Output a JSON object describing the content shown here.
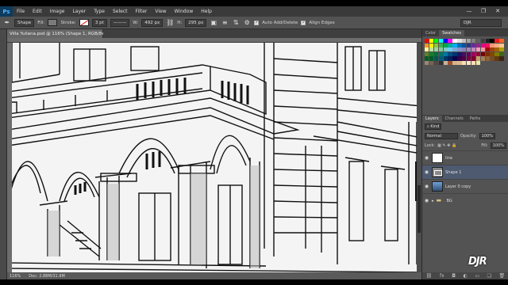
{
  "app": {
    "logo": "Ps"
  },
  "menu": [
    "File",
    "Edit",
    "Image",
    "Layer",
    "Type",
    "Select",
    "Filter",
    "View",
    "Window",
    "Help"
  ],
  "window_controls": [
    "—",
    "❐",
    "✕"
  ],
  "options": {
    "mode": "Shape",
    "fill_label": "Fill:",
    "stroke_label": "Stroke:",
    "stroke_width": "3 pt",
    "w_label": "W:",
    "w_value": "492 px",
    "h_label": "H:",
    "h_value": "295 px",
    "auto_add_delete": "Auto Add/Delete",
    "align_edges": "Align Edges",
    "workspace": "DJR"
  },
  "document": {
    "tab_title": "Villa Yuliana.psd @ 116% (Shape 1, RGB/8#) *",
    "zoom": "116%",
    "doc_size": "Doc: 2.88M/31.9M"
  },
  "panels": {
    "top_tabs": [
      "Color",
      "Swatches"
    ],
    "layer_tabs": [
      "Layers",
      "Channels",
      "Paths"
    ],
    "kind_label": "Kind",
    "blend_mode": "Normal",
    "opacity_label": "Opacity:",
    "opacity_value": "100%",
    "lock_label": "Lock:",
    "fill_label": "Fill:",
    "fill_value": "100%",
    "layers": [
      {
        "name": "line",
        "kind": "white"
      },
      {
        "name": "Shape 1",
        "kind": "shape",
        "selected": true
      },
      {
        "name": "Layer 0 copy",
        "kind": "photo"
      },
      {
        "name": "BG",
        "kind": "folder"
      }
    ],
    "footer_icons": [
      "link-icon",
      "fx-icon",
      "mask-icon",
      "adjustment-icon",
      "folder-icon",
      "new-layer-icon",
      "trash-icon"
    ]
  },
  "swatch_colors": [
    "#ff0000",
    "#ffff00",
    "#00ff00",
    "#00ffff",
    "#0000ff",
    "#ff00ff",
    "#ffffff",
    "#e0e0e0",
    "#c0c0c0",
    "#a0a0a0",
    "#808080",
    "#606060",
    "#404040",
    "#202020",
    "#000000",
    "#ed1c24",
    "#f26522",
    "#f7941d",
    "#fff200",
    "#8dc63f",
    "#39b54a",
    "#00a651",
    "#00a99d",
    "#00aeef",
    "#0072bc",
    "#0054a6",
    "#2e3192",
    "#662d91",
    "#92278f",
    "#ec008c",
    "#ed145b",
    "#f69679",
    "#f9ad81",
    "#fdc68a",
    "#fff799",
    "#c4df9b",
    "#a3d39c",
    "#82ca9c",
    "#7accc8",
    "#6dcff6",
    "#7da7d9",
    "#8393ca",
    "#8781bd",
    "#a186be",
    "#bd8cbf",
    "#f49ac1",
    "#f5989d",
    "#9e0b0f",
    "#a0410d",
    "#a36209",
    "#aba000",
    "#598527",
    "#1a7b30",
    "#007236",
    "#00746b",
    "#0076a3",
    "#004b80",
    "#003471",
    "#1b1464",
    "#440e62",
    "#630460",
    "#9e005d",
    "#9e0039",
    "#790000",
    "#7b2e00",
    "#7d4900",
    "#827b00",
    "#406618",
    "#005e20",
    "#005826",
    "#005952",
    "#005b7f",
    "#003663",
    "#002157",
    "#0d004c",
    "#32004b",
    "#4b0049",
    "#7b0046",
    "#7a0026",
    "#c69c6d",
    "#a67c52",
    "#8c6239",
    "#754c24",
    "#603913",
    "#3c2415",
    "#998675",
    "#736357",
    "#534741",
    "#362f2d",
    "#c7b299",
    "#a0522d",
    "#d2b48c",
    "#deb887",
    "#f5deb3",
    "#ffe4c4",
    "#ffdab9",
    "#eee8aa"
  ],
  "watermark": "DJR"
}
